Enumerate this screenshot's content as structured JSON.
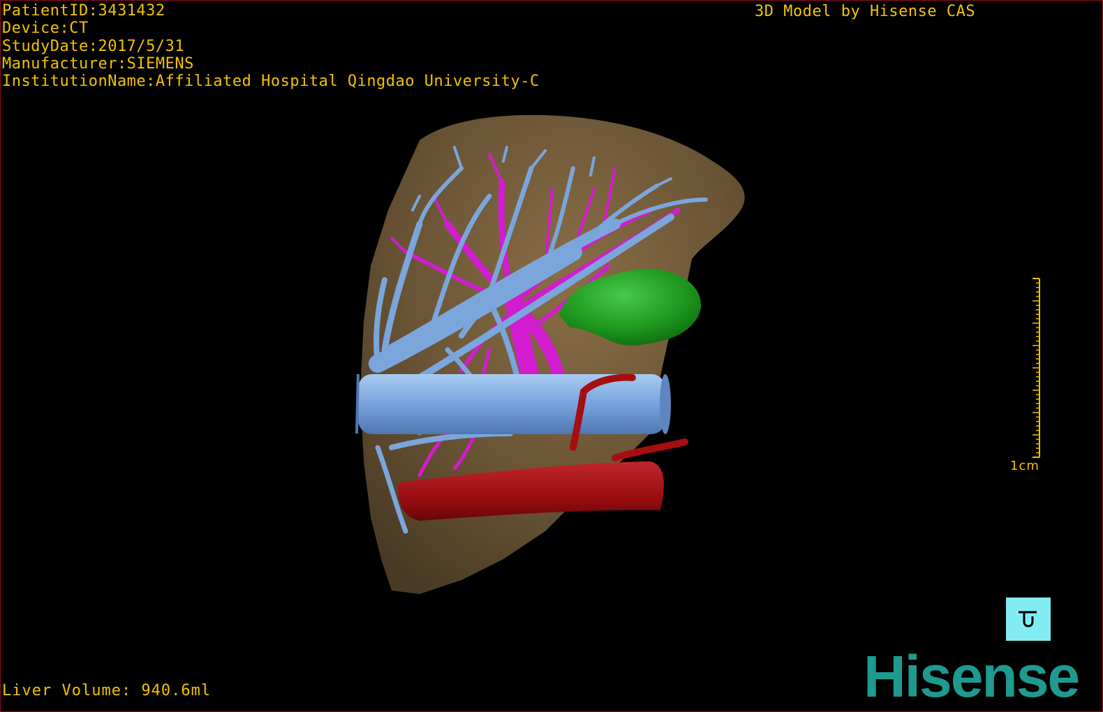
{
  "dicom": {
    "patient_id": "PatientID:3431432",
    "device": "Device:CT",
    "study_date": "StudyDate:2017/5/31",
    "manufacturer": "Manufacturer:SIEMENS",
    "institution": "InstitutionName:Affiliated Hospital Qingdao University-C"
  },
  "watermark": "3D Model by Hisense CAS",
  "liver_volume": "Liver Volume: 940.6ml",
  "scale": {
    "label": "1cm"
  },
  "controls": {
    "reset_icon": "reset-view-icon"
  },
  "brand": {
    "logo_text": "Hisense"
  },
  "colors": {
    "overlay_text": "#f2c200",
    "liver": "#6b5536",
    "portal_vein": "#7aa6dc",
    "hepatic_vein": "#d21ccf",
    "artery": "#a50f12",
    "tumor": "#1f9a1f",
    "reset_button_bg": "#83ecf3",
    "brand": "#1e9a8f"
  }
}
